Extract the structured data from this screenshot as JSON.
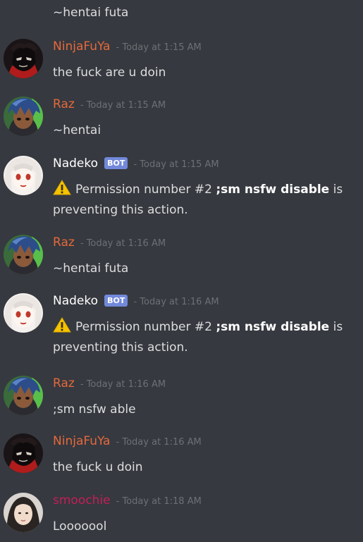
{
  "stub_message": {
    "text": "~hentai futa"
  },
  "users": {
    "ninja": {
      "name": "NinjaFuYa",
      "color": "#e4693c"
    },
    "raz": {
      "name": "Raz",
      "color": "#e4693c"
    },
    "nadeko": {
      "name": "Nadeko",
      "color": "#ffffff",
      "badge": "BOT"
    },
    "smoochie": {
      "name": "smoochie",
      "color": "#c41e5a"
    }
  },
  "messages": [
    {
      "author": "NinjaFuYa",
      "timestamp": "- Today at 1:15 AM",
      "text": "the fuck are u doin",
      "avatar": "ninja-avatar"
    },
    {
      "author": "Raz",
      "timestamp": "- Today at 1:15 AM",
      "text": "~hentai",
      "avatar": "raz-avatar"
    },
    {
      "author": "Nadeko",
      "badge": "BOT",
      "timestamp": "- Today at 1:15 AM",
      "text_prefix": "Permission number #2",
      "command": ";sm nsfw disable",
      "text_suffix": "is preventing this action.",
      "icon": "warning-icon",
      "avatar": "nadeko-avatar"
    },
    {
      "author": "Raz",
      "timestamp": "- Today at 1:16 AM",
      "text": "~hentai futa",
      "avatar": "raz-avatar"
    },
    {
      "author": "Nadeko",
      "badge": "BOT",
      "timestamp": "- Today at 1:16 AM",
      "text_prefix": "Permission number #2",
      "command": ";sm nsfw disable",
      "text_suffix": "is preventing this action.",
      "icon": "warning-icon",
      "avatar": "nadeko-avatar"
    },
    {
      "author": "Raz",
      "timestamp": "- Today at 1:16 AM",
      "text": ";sm nsfw able",
      "avatar": "raz-avatar"
    },
    {
      "author": "NinjaFuYa",
      "timestamp": "- Today at 1:16 AM",
      "text": "the fuck u doin",
      "avatar": "ninja-avatar"
    },
    {
      "author": "smoochie",
      "timestamp": "- Today at 1:18 AM",
      "text": "Looooool",
      "avatar": "smoochie-avatar"
    }
  ],
  "colors": {
    "background": "#36393f",
    "text": "#dcddde",
    "timestamp": "#6d7075",
    "bot_badge": "#7289da",
    "warning": "#f5c400"
  }
}
